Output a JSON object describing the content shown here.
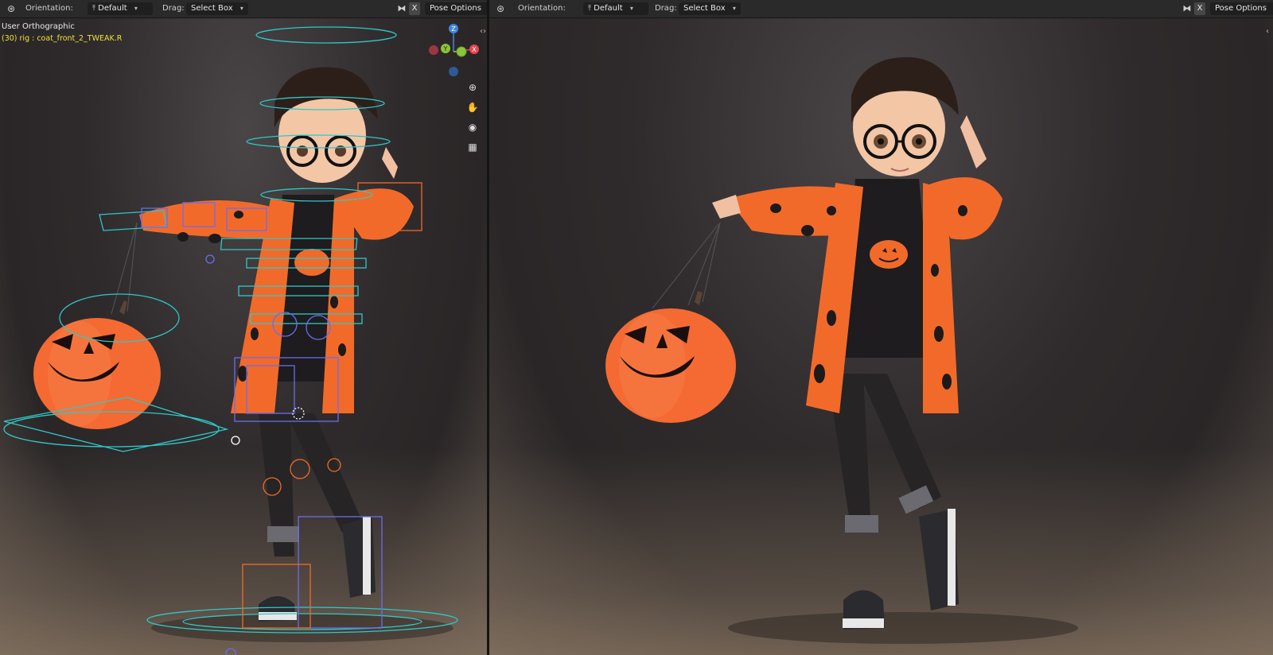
{
  "left_viewport": {
    "header": {
      "orientation_label": "Orientation:",
      "orientation_value": "Default",
      "drag_label": "Drag:",
      "drag_value": "Select Box",
      "x_toggle": "X",
      "pose_options_label": "Pose Options"
    },
    "info": {
      "view_name": "User Orthographic",
      "active_object": "(30) rig : coat_front_2_TWEAK.R"
    },
    "gizmo": {
      "z_label": "Z",
      "y_label": "Y",
      "x_label": "X"
    },
    "nav_tools": [
      "zoom-icon",
      "pan-hand-icon",
      "camera-icon",
      "grid-icon"
    ]
  },
  "right_viewport": {
    "header": {
      "orientation_label": "Orientation:",
      "orientation_value": "Default",
      "drag_label": "Drag:",
      "drag_value": "Select Box",
      "x_toggle": "X",
      "pose_options_label": "Pose Options"
    }
  },
  "colors": {
    "header_bg": "#2a2a2a",
    "info_yellow": "#f0e23a",
    "axis_x": "#e04850",
    "axis_y": "#8cc43a",
    "axis_z": "#3f86e0",
    "rig_cyan": "#2fc8c8",
    "rig_blue": "#6a6cf0",
    "rig_orange": "#f06a2a",
    "coat_orange": "#f26a2a",
    "pumpkin_orange": "#f46a32"
  }
}
